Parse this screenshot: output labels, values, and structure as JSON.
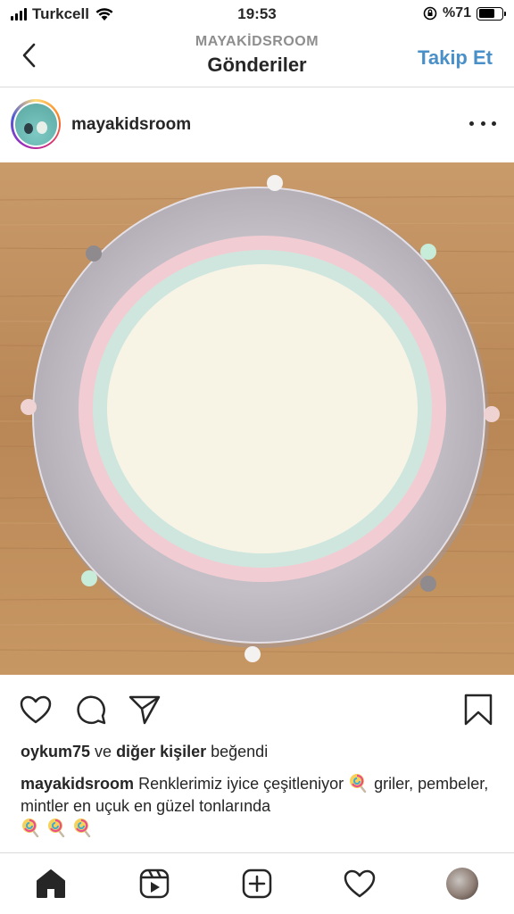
{
  "status_bar": {
    "carrier": "Turkcell",
    "time": "19:53",
    "battery": "%71",
    "battery_level": 0.71
  },
  "nav": {
    "subtitle": "MAYAKİDSROOM",
    "title": "Gönderiler",
    "follow_label": "Takip Et"
  },
  "post": {
    "username": "mayakidsroom",
    "likes": {
      "user": "oykum75",
      "connector": " ve ",
      "others": "diğer kişiler",
      "suffix": " beğendi"
    },
    "caption": {
      "username": "mayakidsroom",
      "text_part1": " Renklerimiz iyice çeşitleniyor ",
      "text_part2": " griler, pembeler, mintler en uçuk en güzel tonlarında "
    }
  },
  "icons": {
    "back": "chevron-left-icon",
    "more": "more-horizontal-icon",
    "like": "heart-icon",
    "comment": "comment-icon",
    "share": "paper-plane-icon",
    "save": "bookmark-icon",
    "lollipop": "lollipop-emoji",
    "home": "home-icon",
    "reels": "reels-icon",
    "create": "plus-square-icon",
    "activity": "heart-icon",
    "profile": "profile-avatar"
  },
  "colors": {
    "accent": "#4a90c8",
    "text": "#262626",
    "muted": "#8e8e8e"
  }
}
